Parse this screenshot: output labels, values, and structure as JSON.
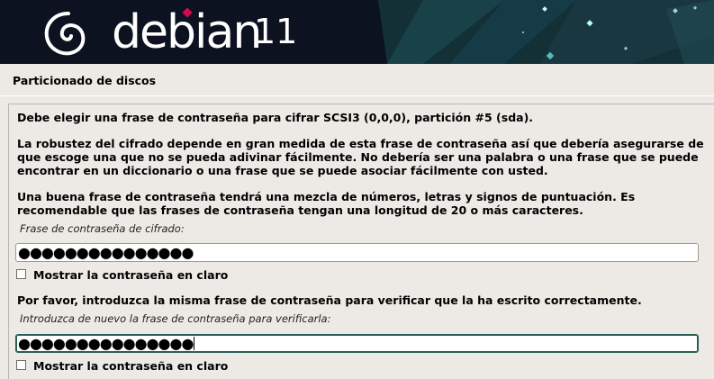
{
  "banner": {
    "wordmark": "debian",
    "version": "11"
  },
  "page": {
    "title": "Particionado de discos"
  },
  "content": {
    "intro": "Debe elegir una frase de contraseña para cifrar SCSI3 (0,0,0), partición #5 (sda).",
    "para1_lines": [
      "La robustez del cifrado depende en gran medida de esta frase de contraseña así que debería asegurarse de",
      "que escoge una que no se pueda adivinar fácilmente. No debería ser una palabra o una frase que se puede",
      "encontrar en un diccionario o una frase que se puede asociar fácilmente con usted."
    ],
    "para2_lines": [
      "Una buena frase de contraseña tendrá una mezcla de números, letras y signos de puntuación. Es",
      "recomendable que las frases de contraseña tengan una longitud de 20 o más caracteres."
    ],
    "passphrase_label": "Frase de contraseña de cifrado:",
    "passphrase_value": "●●●●●●●●●●●●●●●",
    "show_plain_1": "Mostrar la contraseña en claro",
    "verify_prompt": "Por favor, introduzca la misma frase de contraseña para verificar que la ha escrito correctamente.",
    "verify_label": "Introduzca de nuevo la frase de contraseña para verificarla:",
    "verify_value": "●●●●●●●●●●●●●●●",
    "show_plain_2": "Mostrar la contraseña en claro",
    "show_plain_1_checked": false,
    "show_plain_2_checked": false
  },
  "colors": {
    "banner_bg": "#0c1220",
    "page_bg": "#edeae6",
    "accent": "#d70751",
    "focus_border": "#2c5d54"
  }
}
